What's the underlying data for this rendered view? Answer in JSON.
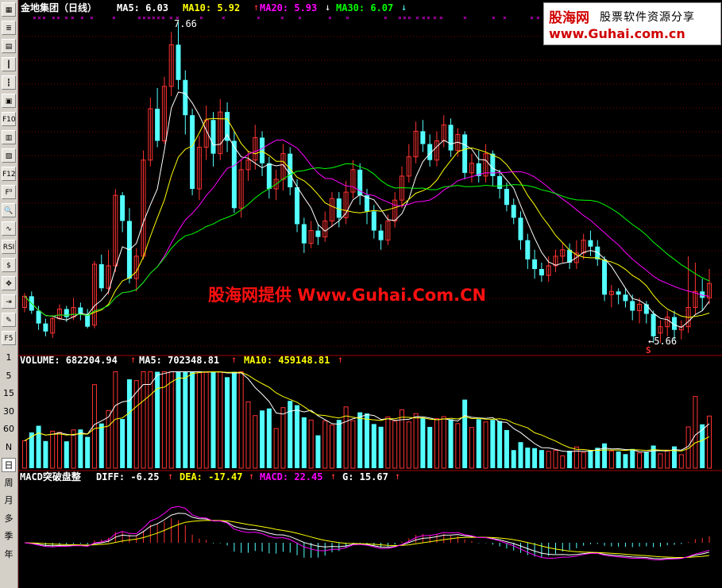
{
  "toolbar": {
    "items": [
      {
        "name": "grid-icon",
        "glyph": "▦"
      },
      {
        "name": "list-icon",
        "glyph": "≣"
      },
      {
        "name": "grid2-icon",
        "glyph": "▤"
      },
      {
        "name": "candlestick-icon",
        "glyph": "┃"
      },
      {
        "name": "candle2-icon",
        "glyph": "┇"
      },
      {
        "name": "report-icon",
        "glyph": "▣"
      },
      {
        "name": "f10-icon",
        "glyph": "F10"
      },
      {
        "name": "news-icon",
        "glyph": "▥"
      },
      {
        "name": "notes-icon",
        "glyph": "▧"
      },
      {
        "name": "f12-icon",
        "glyph": "F12"
      },
      {
        "name": "f10b-icon",
        "glyph": "F⁰"
      },
      {
        "name": "zoom-icon",
        "glyph": "🔍"
      },
      {
        "name": "wave-icon",
        "glyph": "∿"
      },
      {
        "name": "rsi-icon",
        "glyph": "RSI"
      },
      {
        "name": "dollar-icon",
        "glyph": "$"
      },
      {
        "name": "move-icon",
        "glyph": "✥"
      },
      {
        "name": "enter-icon",
        "glyph": "⇥"
      },
      {
        "name": "pencil-icon",
        "glyph": "✎"
      },
      {
        "name": "f5-icon",
        "glyph": "F5"
      }
    ],
    "periods": [
      "1",
      "5",
      "15",
      "30",
      "60",
      "N",
      "日",
      "周",
      "月",
      "多",
      "季",
      "年"
    ]
  },
  "header": {
    "title": "金地集团（日线）",
    "ma5": "MA5: 6.03",
    "ma10": "MA10: 5.92",
    "ma20": "MA20: 5.93",
    "ma30": "MA30: 6.07"
  },
  "volume_header": {
    "volume": "VOLUME: 682204.94",
    "ma5": "MA5: 702348.81",
    "ma10": "MA10: 459148.81"
  },
  "macd_header": {
    "name": "MACD突破盘整",
    "diff": "DIFF: -6.25",
    "dea": "DEA: -17.47",
    "macd": "MACD: 22.45",
    "g": "G: 15.67"
  },
  "annotations": {
    "high": "7.66",
    "low": "←5.66",
    "signal": "S"
  },
  "logo": {
    "brand": "股海网",
    "slogan": "股票软件资源分享",
    "url": "www.Guhai.com.cn"
  },
  "watermark": "股海网提供 Www.Guhai.Com.CN",
  "colors": {
    "up": "#ff3232",
    "down": "#54ffff",
    "white": "#ffffff",
    "yellow": "#ffff00",
    "magenta": "#ff00ff",
    "green": "#00ff00",
    "frame": "#a00000"
  },
  "chart_data": {
    "type": "candlestick",
    "price_range": [
      5.6,
      7.7
    ],
    "candles": [
      [
        5.88,
        5.95,
        5.85,
        5.97
      ],
      [
        5.95,
        5.86,
        5.84,
        5.98
      ],
      [
        5.86,
        5.78,
        5.74,
        5.89
      ],
      [
        5.78,
        5.73,
        5.7,
        5.81
      ],
      [
        5.72,
        5.81,
        5.69,
        5.83
      ],
      [
        5.81,
        5.87,
        5.8,
        5.9
      ],
      [
        5.87,
        5.82,
        5.79,
        5.89
      ],
      [
        5.82,
        5.88,
        5.8,
        5.94
      ],
      [
        5.88,
        5.84,
        5.8,
        5.91
      ],
      [
        5.84,
        5.76,
        5.75,
        5.87
      ],
      [
        5.77,
        6.15,
        5.75,
        6.17
      ],
      [
        6.15,
        6.0,
        5.98,
        6.21
      ],
      [
        6.0,
        6.14,
        5.96,
        6.24
      ],
      [
        6.14,
        6.58,
        6.1,
        6.62
      ],
      [
        6.58,
        6.42,
        6.35,
        6.6
      ],
      [
        6.42,
        6.06,
        6.03,
        6.5
      ],
      [
        6.06,
        6.2,
        5.98,
        6.25
      ],
      [
        6.2,
        6.8,
        6.18,
        6.86
      ],
      [
        6.8,
        7.12,
        6.76,
        7.19
      ],
      [
        7.12,
        6.92,
        6.88,
        7.25
      ],
      [
        6.92,
        7.26,
        6.9,
        7.32
      ],
      [
        7.26,
        7.52,
        7.2,
        7.6
      ],
      [
        7.52,
        7.3,
        7.24,
        7.66
      ],
      [
        7.3,
        7.08,
        6.96,
        7.36
      ],
      [
        7.08,
        6.62,
        6.58,
        7.12
      ],
      [
        6.62,
        6.88,
        6.55,
        6.95
      ],
      [
        6.88,
        7.05,
        6.8,
        7.14
      ],
      [
        7.05,
        6.84,
        6.76,
        7.1
      ],
      [
        6.84,
        7.1,
        6.8,
        7.18
      ],
      [
        7.1,
        6.92,
        6.85,
        7.16
      ],
      [
        6.92,
        6.5,
        6.47,
        6.98
      ],
      [
        6.5,
        6.74,
        6.44,
        6.8
      ],
      [
        6.74,
        6.8,
        6.67,
        6.86
      ],
      [
        6.8,
        6.94,
        6.74,
        7.02
      ],
      [
        6.94,
        6.78,
        6.7,
        6.98
      ],
      [
        6.78,
        6.62,
        6.56,
        6.82
      ],
      [
        6.62,
        6.68,
        6.55,
        6.74
      ],
      [
        6.68,
        6.84,
        6.61,
        6.9
      ],
      [
        6.84,
        6.63,
        6.58,
        6.88
      ],
      [
        6.63,
        6.4,
        6.35,
        6.68
      ],
      [
        6.4,
        6.28,
        6.22,
        6.44
      ],
      [
        6.28,
        6.36,
        6.25,
        6.42
      ],
      [
        6.36,
        6.32,
        6.27,
        6.4
      ],
      [
        6.32,
        6.42,
        6.29,
        6.48
      ],
      [
        6.42,
        6.56,
        6.38,
        6.6
      ],
      [
        6.56,
        6.44,
        6.38,
        6.6
      ],
      [
        6.44,
        6.6,
        6.4,
        6.67
      ],
      [
        6.6,
        6.74,
        6.56,
        6.8
      ],
      [
        6.74,
        6.58,
        6.52,
        6.78
      ],
      [
        6.58,
        6.48,
        6.4,
        6.62
      ],
      [
        6.48,
        6.36,
        6.31,
        6.52
      ],
      [
        6.36,
        6.3,
        6.24,
        6.4
      ],
      [
        6.3,
        6.42,
        6.27,
        6.46
      ],
      [
        6.42,
        6.55,
        6.38,
        6.6
      ],
      [
        6.55,
        6.7,
        6.5,
        6.76
      ],
      [
        6.7,
        6.82,
        6.66,
        6.9
      ],
      [
        6.82,
        6.98,
        6.78,
        7.04
      ],
      [
        6.98,
        6.9,
        6.85,
        7.05
      ],
      [
        6.9,
        6.8,
        6.76,
        6.96
      ],
      [
        6.8,
        6.92,
        6.76,
        6.98
      ],
      [
        6.92,
        7.02,
        6.88,
        7.08
      ],
      [
        7.02,
        6.86,
        6.82,
        7.06
      ],
      [
        6.86,
        6.96,
        6.82,
        7.0
      ],
      [
        6.96,
        6.72,
        6.68,
        6.98
      ],
      [
        6.72,
        6.78,
        6.66,
        6.84
      ],
      [
        6.78,
        6.7,
        6.66,
        6.86
      ],
      [
        6.7,
        6.84,
        6.66,
        6.9
      ],
      [
        6.84,
        6.7,
        6.64,
        6.86
      ],
      [
        6.7,
        6.62,
        6.56,
        6.74
      ],
      [
        6.62,
        6.52,
        6.48,
        6.66
      ],
      [
        6.52,
        6.44,
        6.4,
        6.56
      ],
      [
        6.44,
        6.3,
        6.24,
        6.48
      ],
      [
        6.3,
        6.18,
        6.12,
        6.34
      ],
      [
        6.18,
        6.12,
        6.06,
        6.24
      ],
      [
        6.12,
        6.08,
        6.04,
        6.16
      ],
      [
        6.08,
        6.14,
        6.04,
        6.2
      ],
      [
        6.14,
        6.2,
        6.1,
        6.24
      ],
      [
        6.2,
        6.24,
        6.16,
        6.28
      ],
      [
        6.24,
        6.16,
        6.12,
        6.28
      ],
      [
        6.16,
        6.22,
        6.12,
        6.3
      ],
      [
        6.22,
        6.3,
        6.18,
        6.34
      ],
      [
        6.3,
        6.26,
        6.2,
        6.36
      ],
      [
        6.26,
        6.18,
        6.14,
        6.3
      ],
      [
        6.18,
        5.96,
        5.92,
        6.2
      ],
      [
        5.96,
        5.98,
        5.88,
        6.02
      ],
      [
        5.98,
        5.96,
        5.9,
        6.0
      ],
      [
        5.96,
        5.92,
        5.88,
        6.0
      ],
      [
        5.92,
        5.86,
        5.8,
        5.96
      ],
      [
        5.86,
        5.9,
        5.78,
        5.94
      ],
      [
        5.9,
        5.84,
        5.78,
        5.92
      ],
      [
        5.84,
        5.7,
        5.66,
        5.86
      ],
      [
        5.72,
        5.76,
        5.66,
        5.8
      ],
      [
        5.76,
        5.82,
        5.7,
        5.86
      ],
      [
        5.82,
        5.74,
        5.68,
        5.86
      ],
      [
        5.74,
        5.76,
        5.68,
        5.8
      ],
      [
        5.76,
        5.88,
        5.72,
        6.2
      ],
      [
        5.88,
        5.98,
        5.84,
        6.16
      ],
      [
        5.98,
        5.94,
        5.86,
        6.06
      ],
      [
        5.94,
        6.03,
        5.9,
        6.12
      ]
    ],
    "volume_range": [
      0,
      1400000
    ],
    "macd_range": [
      -60,
      70
    ]
  }
}
